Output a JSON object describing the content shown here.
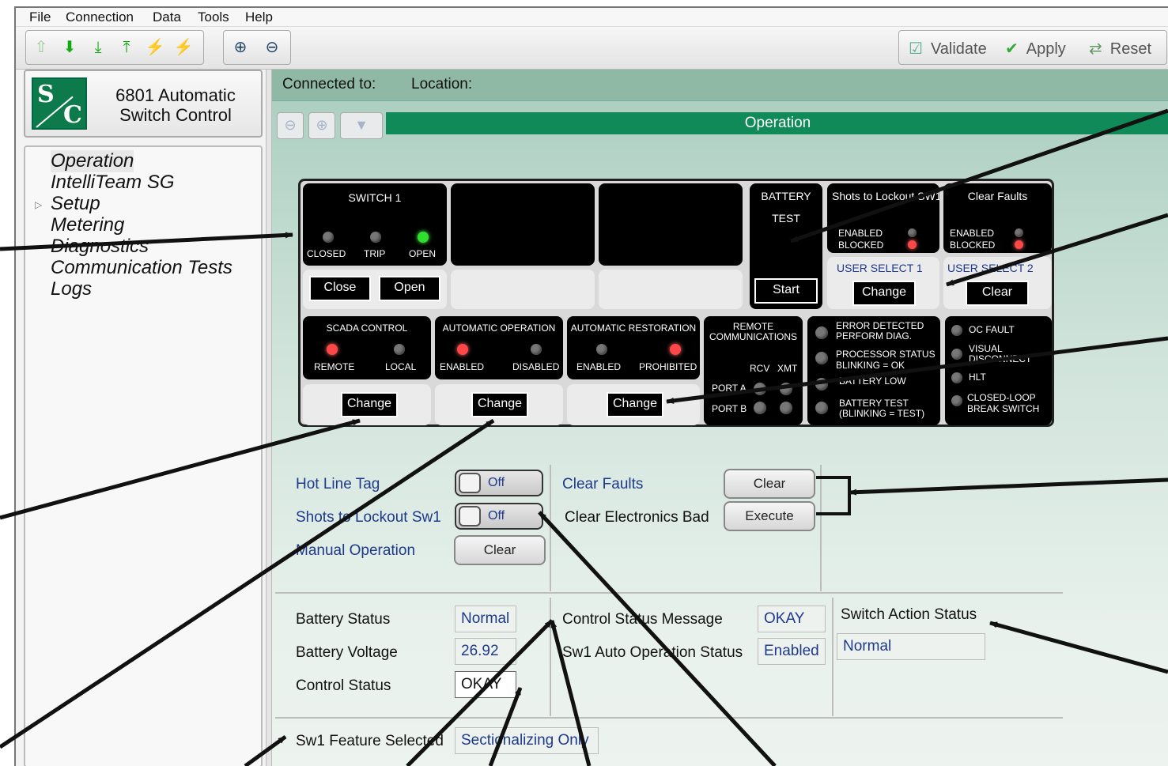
{
  "menu": [
    "File",
    "Connection",
    "Data",
    "Tools",
    "Help"
  ],
  "toolbar": {
    "validate_label": "Validate",
    "apply_label": "Apply",
    "reset_label": "Reset"
  },
  "product": {
    "logo_top": "S",
    "logo_bottom": "C",
    "name_line1": "6801 Automatic",
    "name_line2": "Switch Control"
  },
  "sidebar": {
    "items": [
      {
        "label": "Operation"
      },
      {
        "label": "IntelliTeam SG"
      },
      {
        "label": "Setup"
      },
      {
        "label": "Metering"
      },
      {
        "label": "Diagnostics"
      },
      {
        "label": "Communication Tests"
      },
      {
        "label": "Logs"
      }
    ]
  },
  "header": {
    "connected_to": "Connected to:",
    "location": "Location:",
    "page_title": "Operation"
  },
  "panel": {
    "switch1": {
      "title": "SWITCH 1",
      "closed": "CLOSED",
      "trip": "TRIP",
      "open": "OPEN",
      "close_btn": "Close",
      "open_btn": "Open"
    },
    "battery": {
      "title": "BATTERY",
      "test": "TEST",
      "start_btn": "Start"
    },
    "shots": {
      "title": "Shots to Lockout SW1",
      "enabled": "ENABLED",
      "blocked": "BLOCKED",
      "user_select": "USER SELECT 1",
      "btn": "Change"
    },
    "clear_faults": {
      "title": "Clear Faults",
      "enabled": "ENABLED",
      "blocked": "BLOCKED",
      "user_select": "USER SELECT 2",
      "btn": "Clear"
    },
    "scada": {
      "title": "SCADA CONTROL",
      "left": "REMOTE",
      "right": "LOCAL",
      "btn": "Change"
    },
    "auto_op": {
      "title": "AUTOMATIC OPERATION",
      "left": "ENABLED",
      "right": "DISABLED",
      "btn": "Change"
    },
    "auto_rest": {
      "title": "AUTOMATIC RESTORATION",
      "left": "ENABLED",
      "right": "PROHIBITED",
      "btn": "Change"
    },
    "remote": {
      "title1": "REMOTE",
      "title2": "COMMUNICATIONS",
      "rcv": "RCV",
      "xmt": "XMT",
      "port_a": "PORT A",
      "port_b": "PORT B"
    },
    "diag": {
      "err1": "ERROR DETECTED",
      "err2": "PERFORM DIAG.",
      "proc1": "PROCESSOR STATUS",
      "proc2": "BLINKING = OK",
      "batt_low": "BATTERY LOW",
      "bt1": "BATTERY TEST",
      "bt2": "(BLINKING = TEST)"
    },
    "faults": {
      "oc": "OC FAULT",
      "vis1": "VISUAL",
      "vis2": "DISCONNECT",
      "hlt": "HLT",
      "cl1": "CLOSED-LOOP",
      "cl2": "BREAK SWITCH"
    }
  },
  "controls": {
    "hot_line_tag": {
      "label": "Hot Line Tag",
      "value": "Off"
    },
    "shots_lockout": {
      "label": "Shots to Lockout Sw1",
      "value": "Off"
    },
    "manual_op": {
      "label": "Manual Operation",
      "btn": "Clear"
    },
    "clear_faults": {
      "label": "Clear Faults",
      "btn": "Clear"
    },
    "clear_elec": {
      "label": "Clear Electronics Bad",
      "btn": "Execute"
    }
  },
  "status": {
    "battery_status": {
      "label": "Battery Status",
      "value": "Normal"
    },
    "battery_voltage": {
      "label": "Battery Voltage",
      "value": "26.92"
    },
    "control_status": {
      "label": "Control Status",
      "value": "OKAY"
    },
    "control_status_msg": {
      "label": "Control Status Message",
      "value": "OKAY"
    },
    "sw1_auto_op": {
      "label": "Sw1 Auto Operation Status",
      "value": "Enabled"
    },
    "switch_action": {
      "label": "Switch Action Status",
      "value": "Normal"
    },
    "feature": {
      "label": "Sw1 Feature Selected",
      "value": "Sectionalizing Only"
    }
  },
  "colors": {
    "accent_green": "#0f8a58",
    "label_blue": "#1d3a8a",
    "led_red": "#ff4747",
    "led_green": "#2fe02f"
  }
}
